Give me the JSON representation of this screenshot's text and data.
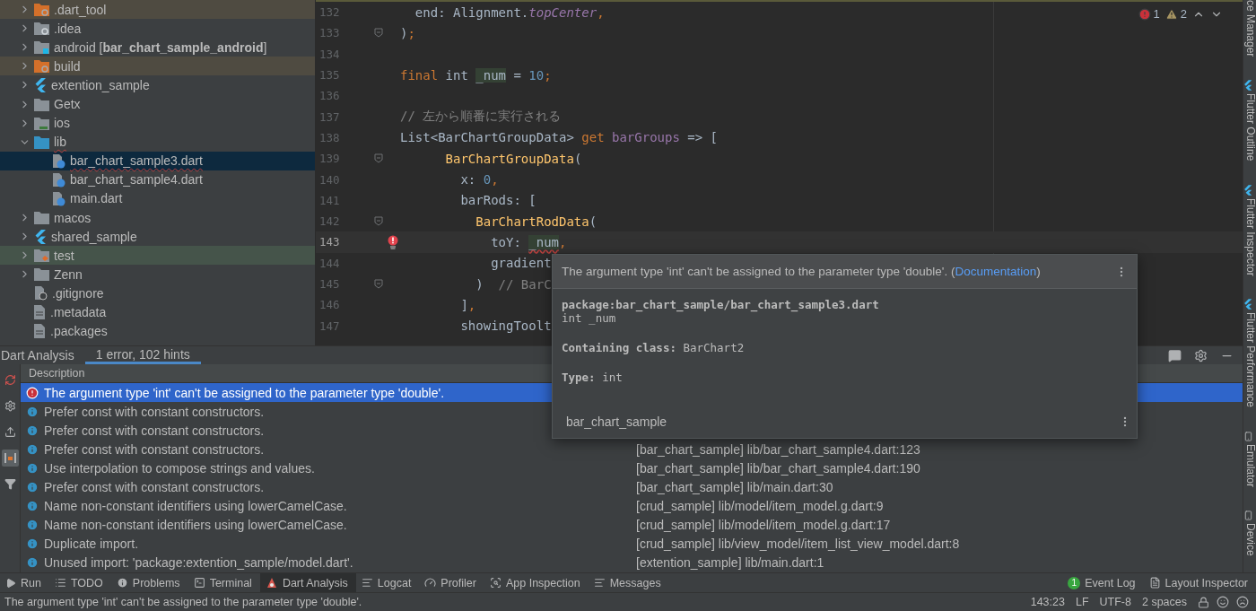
{
  "project_tree": {
    "items": [
      {
        "name": ".dart_tool",
        "kind": "excluded",
        "expanded": false,
        "selected": false,
        "error": false
      },
      {
        "name": ".idea",
        "kind": "config",
        "expanded": false,
        "selected": false,
        "error": false
      },
      {
        "name": "android [**bar_chart_sample_android**]",
        "kind": "module",
        "expanded": false,
        "selected": false,
        "error": false
      },
      {
        "name": "build",
        "kind": "excluded",
        "expanded": false,
        "selected": false,
        "error": false
      },
      {
        "name": "extention_sample",
        "kind": "flutter",
        "expanded": false,
        "selected": false,
        "error": false
      },
      {
        "name": "Getx",
        "kind": "folder",
        "expanded": false,
        "selected": false,
        "error": false
      },
      {
        "name": "ios",
        "kind": "ios",
        "expanded": false,
        "selected": false,
        "error": false
      },
      {
        "name": "lib",
        "kind": "source",
        "expanded": true,
        "selected": false,
        "error": true,
        "children": [
          {
            "name": "bar_chart_sample3.dart",
            "kind": "dart",
            "selected": true,
            "error": true
          },
          {
            "name": "bar_chart_sample4.dart",
            "kind": "dart",
            "selected": false,
            "error": false
          },
          {
            "name": "main.dart",
            "kind": "dart",
            "selected": false,
            "error": false
          }
        ]
      },
      {
        "name": "macos",
        "kind": "folder",
        "expanded": false,
        "selected": false,
        "error": false
      },
      {
        "name": "shared_sample",
        "kind": "flutter",
        "expanded": false,
        "selected": false,
        "error": false
      },
      {
        "name": "test",
        "kind": "test",
        "expanded": false,
        "selected": false,
        "error": false
      },
      {
        "name": "Zenn",
        "kind": "folder",
        "expanded": false,
        "selected": false,
        "error": false
      },
      {
        "name": ".gitignore",
        "kind": "ignore",
        "selected": false,
        "error": false
      },
      {
        "name": ".metadata",
        "kind": "text",
        "selected": false,
        "error": false
      },
      {
        "name": ".packages",
        "kind": "text",
        "selected": false,
        "error": false
      }
    ]
  },
  "editor": {
    "inspection": {
      "errors": "1",
      "warnings": "2"
    },
    "lines": [
      {
        "number": "132",
        "fold": false,
        "current": false,
        "error": false,
        "tokens": [
          {
            "kind": "plain",
            "text": "  end: Alignment."
          },
          {
            "kind": "static",
            "text": "topCenter"
          },
          {
            "kind": "keyword",
            "text": ","
          }
        ]
      },
      {
        "number": "133",
        "fold": true,
        "current": false,
        "error": false,
        "tokens": [
          {
            "kind": "plain",
            "text": ")"
          },
          {
            "kind": "keyword",
            "text": ";"
          }
        ]
      },
      {
        "number": "134",
        "fold": false,
        "current": false,
        "error": false
      },
      {
        "number": "135",
        "fold": false,
        "current": false,
        "error": false,
        "tokens": [
          {
            "kind": "keyword",
            "text": "final "
          },
          {
            "kind": "plain",
            "text": "int "
          },
          {
            "kind": "usage",
            "text": "_num"
          },
          {
            "kind": "plain",
            "text": " = "
          },
          {
            "kind": "number",
            "text": "10"
          },
          {
            "kind": "keyword",
            "text": ";"
          }
        ]
      },
      {
        "number": "136",
        "fold": false,
        "current": false,
        "error": false
      },
      {
        "number": "137",
        "fold": false,
        "current": false,
        "error": false,
        "tokens": [
          {
            "kind": "comment",
            "text": "// 左から順番に実行される"
          }
        ]
      },
      {
        "number": "138",
        "fold": false,
        "current": false,
        "error": false,
        "tokens": [
          {
            "kind": "plain",
            "text": "List<BarChartGroupData> "
          },
          {
            "kind": "keyword",
            "text": "get "
          },
          {
            "kind": "member",
            "text": "barGroups"
          },
          {
            "kind": "plain",
            "text": " => ["
          }
        ]
      },
      {
        "number": "139",
        "fold": true,
        "current": false,
        "error": false,
        "tokens": [
          {
            "kind": "call",
            "text": "      BarChartGroupData"
          },
          {
            "kind": "plain",
            "text": "("
          }
        ]
      },
      {
        "number": "140",
        "fold": false,
        "current": false,
        "error": false,
        "tokens": [
          {
            "kind": "plain",
            "text": "        x: "
          },
          {
            "kind": "number",
            "text": "0"
          },
          {
            "kind": "keyword",
            "text": ","
          }
        ]
      },
      {
        "number": "141",
        "fold": false,
        "current": false,
        "error": false,
        "tokens": [
          {
            "kind": "plain",
            "text": "        barRods: ["
          }
        ]
      },
      {
        "number": "142",
        "fold": true,
        "current": false,
        "error": false,
        "tokens": [
          {
            "kind": "call",
            "text": "          BarChartRodData"
          },
          {
            "kind": "plain",
            "text": "("
          }
        ]
      },
      {
        "number": "143",
        "fold": false,
        "current": true,
        "error": true,
        "tokens": [
          {
            "kind": "plain",
            "text": "            toY: "
          },
          {
            "kind": "error",
            "text": "_num"
          },
          {
            "kind": "keyword",
            "text": ","
          }
        ]
      },
      {
        "number": "144",
        "fold": false,
        "current": false,
        "error": false,
        "tokens": [
          {
            "kind": "plain",
            "text": "            gradient"
          }
        ]
      },
      {
        "number": "145",
        "fold": true,
        "current": false,
        "error": false,
        "tokens": [
          {
            "kind": "plain",
            "text": "          )  "
          },
          {
            "kind": "comment",
            "text": "// BarC"
          }
        ]
      },
      {
        "number": "146",
        "fold": false,
        "current": false,
        "error": false,
        "tokens": [
          {
            "kind": "plain",
            "text": "        ]"
          },
          {
            "kind": "keyword",
            "text": ","
          }
        ]
      },
      {
        "number": "147",
        "fold": false,
        "current": false,
        "error": false,
        "tokens": [
          {
            "kind": "plain",
            "text": "        showingToolt"
          }
        ]
      }
    ]
  },
  "side_tabs": [
    {
      "label": "ce Manager",
      "kind": "plain"
    },
    {
      "label": "Flutter Outline",
      "kind": "flutter"
    },
    {
      "label": "Flutter Inspector",
      "kind": "flutter"
    },
    {
      "label": "Flutter Performance",
      "kind": "flutter"
    },
    {
      "label": "Emulator",
      "kind": "device"
    },
    {
      "label": "Device",
      "kind": "device"
    }
  ],
  "analysis": {
    "title": "Dart Analysis",
    "tabs": [
      {
        "label": "1 error, 102 hints",
        "selected": true
      }
    ],
    "column": "Description",
    "rows": [
      {
        "kind": "error",
        "selected": true,
        "description": "The argument type 'int' can't be assigned to the parameter type 'double'."
      },
      {
        "kind": "info",
        "selected": false,
        "description": "Prefer const with constant constructors."
      },
      {
        "kind": "info",
        "selected": false,
        "description": "Prefer const with constant constructors."
      },
      {
        "kind": "info",
        "selected": false,
        "description": "Prefer const with constant constructors.",
        "location": "[bar_chart_sample] lib/bar_chart_sample4.dart:123"
      },
      {
        "kind": "info",
        "selected": false,
        "description": "Use interpolation to compose strings and values.",
        "location": "[bar_chart_sample] lib/bar_chart_sample4.dart:190"
      },
      {
        "kind": "info",
        "selected": false,
        "description": "Prefer const with constant constructors.",
        "location": "[bar_chart_sample] lib/main.dart:30"
      },
      {
        "kind": "info",
        "selected": false,
        "description": "Name non-constant identifiers using lowerCamelCase.",
        "location": "[crud_sample] lib/model/item_model.g.dart:9"
      },
      {
        "kind": "info",
        "selected": false,
        "description": "Name non-constant identifiers using lowerCamelCase.",
        "location": "[crud_sample] lib/model/item_model.g.dart:17"
      },
      {
        "kind": "info",
        "selected": false,
        "description": "Duplicate import.",
        "location": "[crud_sample] lib/view_model/item_list_view_model.dart:8"
      },
      {
        "kind": "info",
        "selected": false,
        "description": "Unused import: 'package:extention_sample/model.dart'.",
        "location": "[extention_sample] lib/main.dart:1"
      }
    ]
  },
  "popup": {
    "message": "The argument type 'int' can't be assigned to the parameter type 'double'. (",
    "link": "Documentation",
    "message_end": ")",
    "path": "package:bar_chart_sample/bar_chart_sample3.dart",
    "signature": "int _num",
    "details": [
      "**Containing class:** BarChart2",
      "**Type:** int"
    ],
    "footer": "bar_chart_sample"
  },
  "tool_windows": [
    {
      "label": "Run",
      "kind": "run",
      "selected": false
    },
    {
      "label": "TODO",
      "kind": "list",
      "selected": false
    },
    {
      "label": "Problems",
      "kind": "problems",
      "selected": false
    },
    {
      "label": "Terminal",
      "kind": "terminal",
      "selected": false
    },
    {
      "label": "Dart Analysis",
      "kind": "dart",
      "selected": true
    },
    {
      "label": "Logcat",
      "kind": "lines",
      "selected": false
    },
    {
      "label": "Profiler",
      "kind": "gauge",
      "selected": false
    },
    {
      "label": "App Inspection",
      "kind": "inspect",
      "selected": false
    },
    {
      "label": "Messages",
      "kind": "lines",
      "selected": false
    }
  ],
  "right_tools": [
    {
      "label": "Event Log",
      "badge": "1"
    },
    {
      "label": "Layout Inspector"
    }
  ],
  "status_bar": {
    "message": "The argument type 'int' can't be assigned to the parameter type 'double'.",
    "items": [
      "143:23",
      "LF",
      "UTF-8",
      "2 spaces"
    ]
  }
}
